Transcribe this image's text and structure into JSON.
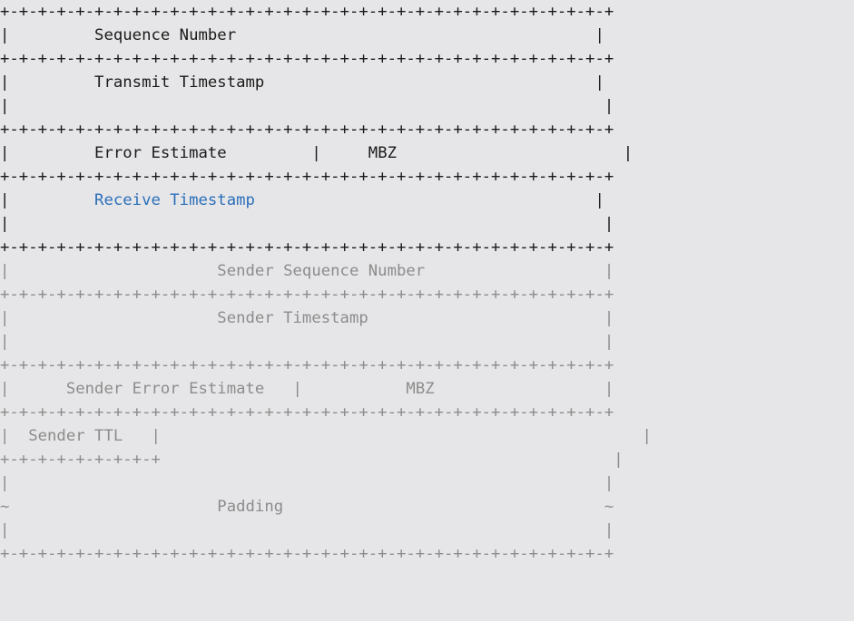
{
  "fields": {
    "sequence_number": "Sequence Number",
    "transmit_timestamp": "Transmit Timestamp",
    "error_estimate": "Error Estimate",
    "mbz": "MBZ",
    "receive_timestamp": "Receive Timestamp",
    "sender_sequence_number": "Sender Sequence Number",
    "sender_timestamp": "Sender Timestamp",
    "sender_error_estimate": "Sender Error Estimate",
    "sender_mbz": "MBZ",
    "sender_ttl": "Sender TTL",
    "padding": "Padding"
  },
  "colors": {
    "background": "#e6e6e8",
    "text_dark": "#1a1a1a",
    "text_light": "#8c8c8c",
    "highlight": "#2a6fba"
  }
}
